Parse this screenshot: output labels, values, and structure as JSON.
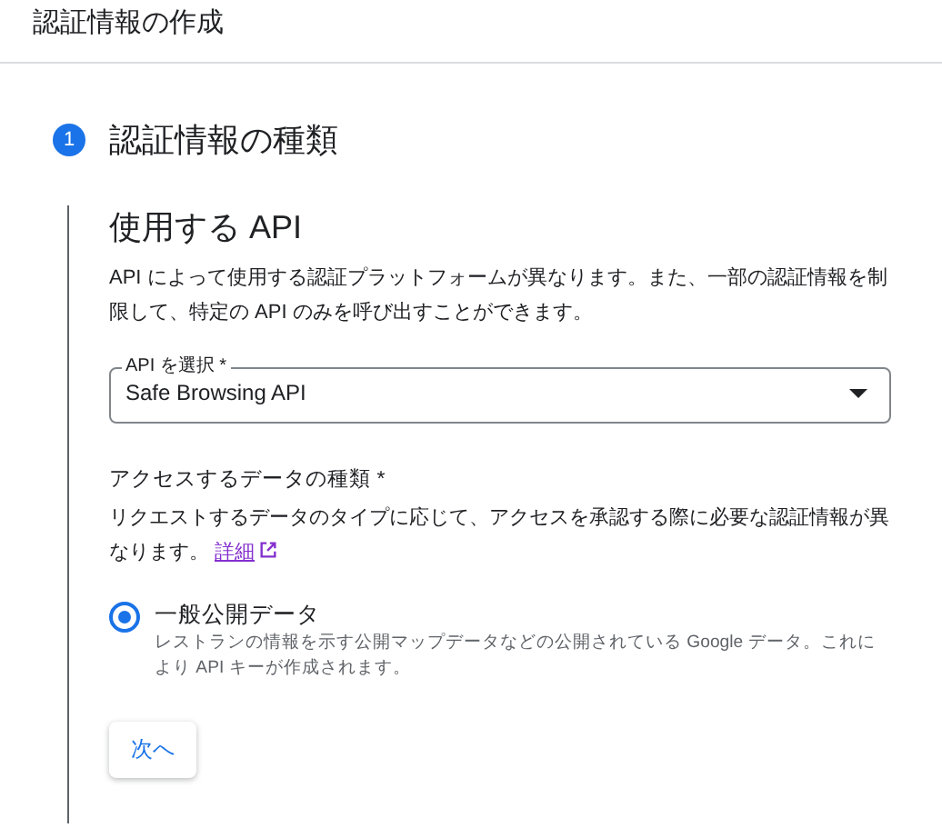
{
  "header": {
    "title": "認証情報の作成"
  },
  "step": {
    "number": "1",
    "title": "認証情報の種類"
  },
  "section": {
    "title": "使用する API",
    "description": "API によって使用する認証プラットフォームが異なります。また、一部の認証情報を制限して、特定の API のみを呼び出すことができます。"
  },
  "api_select": {
    "label": "API を選択 *",
    "value": "Safe Browsing API"
  },
  "data_type": {
    "label": "アクセスするデータの種類 *",
    "description": "リクエストするデータのタイプに応じて、アクセスを承認する際に必要な認証情報が異なります。",
    "link": "詳細",
    "options": [
      {
        "label": "一般公開データ",
        "description": "レストランの情報を示す公開マップデータなどの公開されている Google データ。これにより API キーが作成されます。",
        "selected": true
      }
    ]
  },
  "next_button": "次へ"
}
